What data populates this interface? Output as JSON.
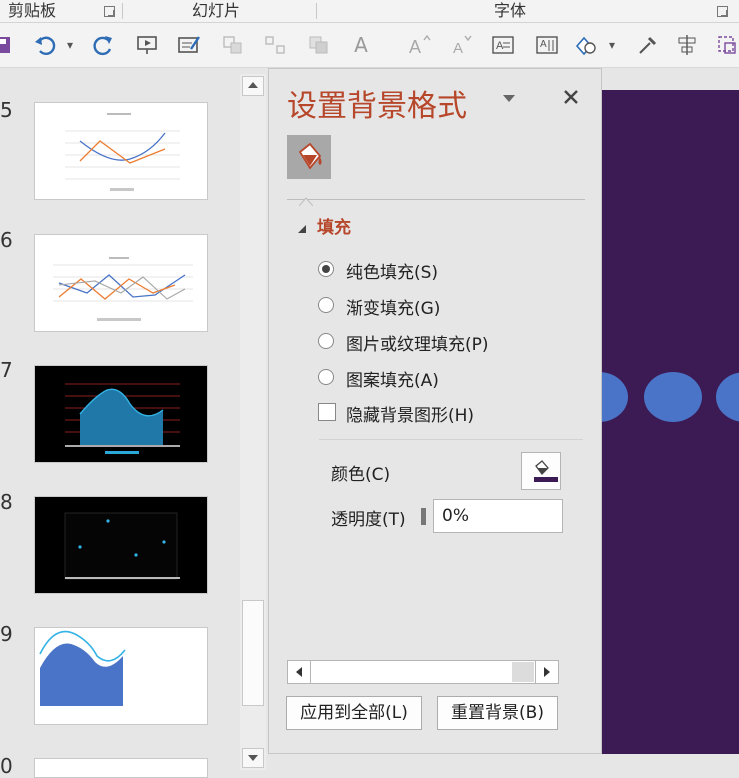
{
  "ribbon": {
    "groups": {
      "clipboard": "剪贴板",
      "slides": "幻灯片",
      "font": "字体"
    }
  },
  "toolbar": {
    "font_glyph": "A",
    "icons": [
      "save-icon",
      "undo-icon",
      "redo-icon",
      "slideshow-icon",
      "edit-shape-icon",
      "group-icon",
      "ungroup-icon",
      "arrange-icon",
      "text-fill-icon",
      "font-grow-icon",
      "font-shrink-icon",
      "text-box-icon",
      "vertical-text-icon",
      "shape-icon",
      "eyedropper-icon",
      "align-icon",
      "selection-icon"
    ]
  },
  "thumbnails": [
    {
      "number": "5"
    },
    {
      "number": "6"
    },
    {
      "number": "7"
    },
    {
      "number": "8"
    },
    {
      "number": "9"
    },
    {
      "number": "0"
    }
  ],
  "pane": {
    "title": "设置背景格式",
    "section": "填充",
    "options": [
      {
        "label": "纯色填充(S)",
        "selected": true
      },
      {
        "label": "渐变填充(G)",
        "selected": false
      },
      {
        "label": "图片或纹理填充(P)",
        "selected": false
      },
      {
        "label": "图案填充(A)",
        "selected": false
      }
    ],
    "hide_graphics_label": "隐藏背景图形(H)",
    "color_label": "颜色(C)",
    "transparency_label": "透明度(T)",
    "transparency_value": "0%",
    "apply_all_label": "应用到全部(L)",
    "reset_label": "重置背景(B)"
  },
  "colors": {
    "accent": "#b7472a",
    "canvas": "#3c1a54",
    "dots": "#4a74c7",
    "fill_swatch": "#3c1a54"
  }
}
